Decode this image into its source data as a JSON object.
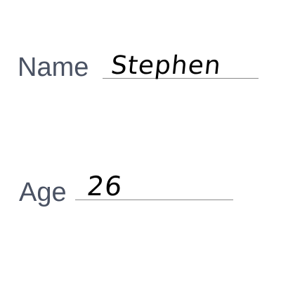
{
  "form": {
    "name_field": {
      "label": "Name",
      "value": "Stephen"
    },
    "age_field": {
      "label": "Age",
      "value": "26"
    }
  },
  "colors": {
    "label_text": "#4a5263",
    "handwriting_ink": "#000000",
    "underline": "#8a8a8a",
    "background": "#ffffff"
  }
}
